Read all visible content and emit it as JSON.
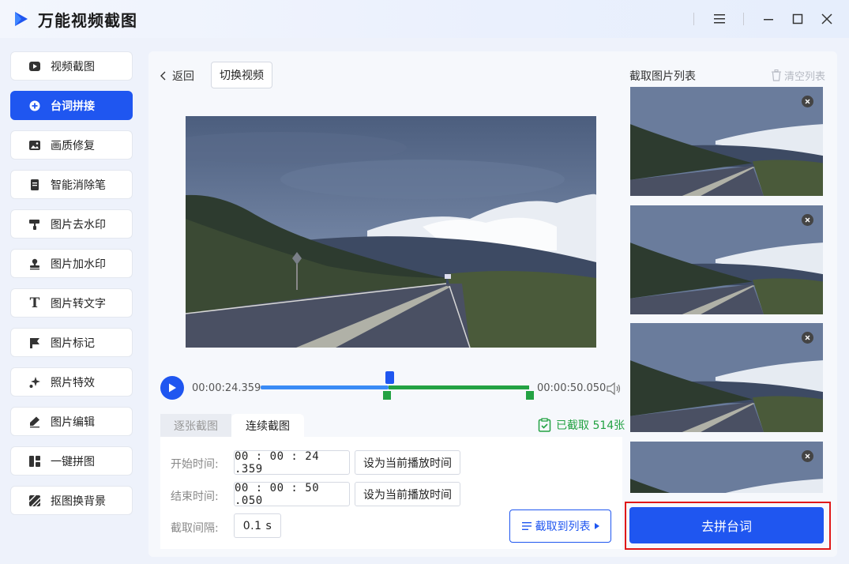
{
  "app": {
    "title": "万能视频截图"
  },
  "sidebar": {
    "items": [
      {
        "label": "视频截图",
        "icon": "video-play-icon"
      },
      {
        "label": "台词拼接",
        "icon": "plus-circle-icon",
        "active": true
      },
      {
        "label": "画质修复",
        "icon": "image-icon"
      },
      {
        "label": "智能消除笔",
        "icon": "document-icon"
      },
      {
        "label": "图片去水印",
        "icon": "paint-roller-icon"
      },
      {
        "label": "图片加水印",
        "icon": "stamp-icon"
      },
      {
        "label": "图片转文字",
        "icon": "text-t-icon"
      },
      {
        "label": "图片标记",
        "icon": "flag-icon"
      },
      {
        "label": "照片特效",
        "icon": "sparkle-icon"
      },
      {
        "label": "图片编辑",
        "icon": "pencil-icon"
      },
      {
        "label": "一键拼图",
        "icon": "collage-icon"
      },
      {
        "label": "抠图换背景",
        "icon": "stripes-icon"
      }
    ]
  },
  "toolbar": {
    "back_label": "返回",
    "switch_video_label": "切换视频"
  },
  "player": {
    "current_time": "00:00:24.359",
    "end_time": "00:00:50.050"
  },
  "tabs": {
    "single": "逐张截图",
    "continuous": "连续截图"
  },
  "captured": {
    "label": "已截取 514张"
  },
  "form": {
    "start_label": "开始时间:",
    "start_value": "00 : 00 : 24 .359",
    "end_label": "结束时间:",
    "end_value": "00 : 00 : 50 .050",
    "set_current_label": "设为当前播放时间",
    "interval_label": "截取间隔:",
    "interval_value": "0.1  s",
    "to_list_label": "截取到列表"
  },
  "list": {
    "title": "截取图片列表",
    "clear_label": "清空列表",
    "go_button": "去拼台词"
  },
  "colors": {
    "accent": "#1f56f0",
    "green": "#23a243",
    "highlight": "#e01818"
  }
}
